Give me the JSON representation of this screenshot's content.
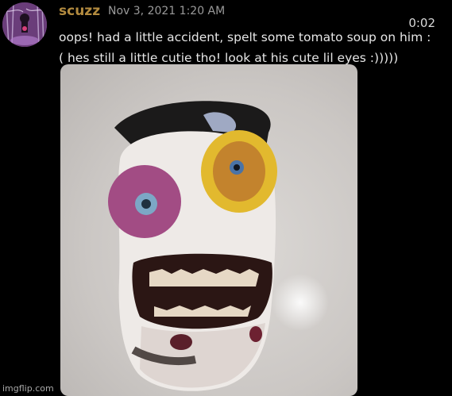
{
  "message": {
    "username": "scuzz",
    "timestamp": "Nov 3, 2021 1:20 AM",
    "line1": "oops! had a little accident, spelt some tomato soup on him :",
    "line2": "( hes still a little cutie tho! look at his cute lil eyes :)))))"
  },
  "video": {
    "timer": "0:02"
  },
  "watermark": "imgflip.com",
  "colors": {
    "background": "#000000",
    "username": "#b38b3f",
    "message_text": "#e6e6e6",
    "timestamp": "#9a9a9a"
  }
}
